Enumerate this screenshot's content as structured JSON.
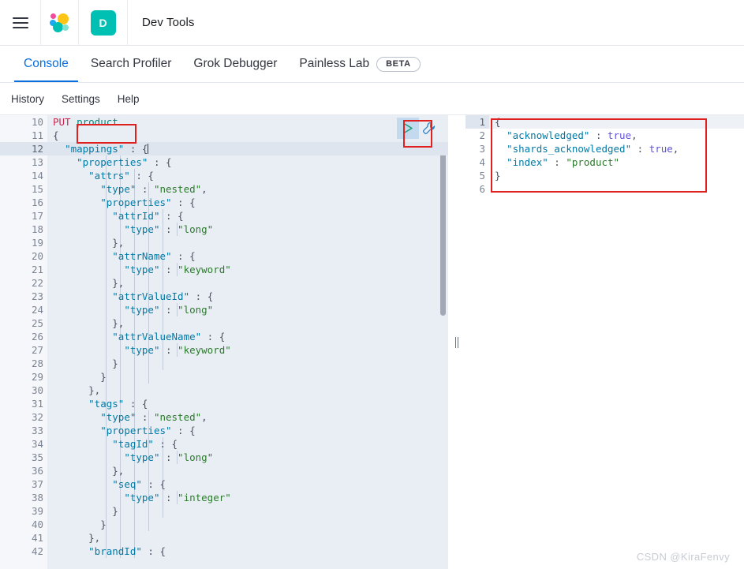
{
  "header": {
    "menu_icon": "hamburger-menu-icon",
    "logo_icon": "elastic-logo-icon",
    "app_badge": "D",
    "app_title": "Dev Tools"
  },
  "tabs": [
    {
      "label": "Console",
      "active": true,
      "badge": null
    },
    {
      "label": "Search Profiler",
      "active": false,
      "badge": null
    },
    {
      "label": "Grok Debugger",
      "active": false,
      "badge": null
    },
    {
      "label": "Painless Lab",
      "active": false,
      "badge": "BETA"
    }
  ],
  "subnav": [
    {
      "label": "History"
    },
    {
      "label": "Settings"
    },
    {
      "label": "Help"
    }
  ],
  "toolbar": {
    "play_label": "send-request",
    "wrench_label": "console-options"
  },
  "request_editor": {
    "first_line_number": 10,
    "active_line": 12,
    "lines": [
      {
        "n": 10,
        "fold": "",
        "indent": 0,
        "tokens": [
          {
            "t": "PUT",
            "c": "k-method"
          },
          {
            "t": " ",
            "c": "k-punct"
          },
          {
            "t": "product",
            "c": "k-url"
          }
        ]
      },
      {
        "n": 11,
        "fold": "▾",
        "indent": 0,
        "tokens": [
          {
            "t": "{",
            "c": "k-punct"
          }
        ]
      },
      {
        "n": 12,
        "fold": "▾",
        "indent": 1,
        "tokens": [
          {
            "t": "\"mappings\"",
            "c": "k-key"
          },
          {
            "t": " : ",
            "c": "k-punct"
          },
          {
            "t": "{",
            "c": "k-punct"
          },
          {
            "t": "|CARET|",
            "c": "caret"
          }
        ]
      },
      {
        "n": 13,
        "fold": "▾",
        "indent": 2,
        "tokens": [
          {
            "t": "\"properties\"",
            "c": "k-key"
          },
          {
            "t": " : ",
            "c": "k-punct"
          },
          {
            "t": "{",
            "c": "k-punct"
          }
        ]
      },
      {
        "n": 14,
        "fold": "▾",
        "indent": 3,
        "tokens": [
          {
            "t": "\"attrs\"",
            "c": "k-key"
          },
          {
            "t": " : ",
            "c": "k-punct"
          },
          {
            "t": "{",
            "c": "k-punct"
          }
        ]
      },
      {
        "n": 15,
        "fold": "",
        "indent": 4,
        "tokens": [
          {
            "t": "\"type\"",
            "c": "k-key"
          },
          {
            "t": " : ",
            "c": "k-punct"
          },
          {
            "t": "\"nested\"",
            "c": "k-str"
          },
          {
            "t": ",",
            "c": "k-punct"
          }
        ]
      },
      {
        "n": 16,
        "fold": "▾",
        "indent": 4,
        "tokens": [
          {
            "t": "\"properties\"",
            "c": "k-key"
          },
          {
            "t": " : ",
            "c": "k-punct"
          },
          {
            "t": "{",
            "c": "k-punct"
          }
        ]
      },
      {
        "n": 17,
        "fold": "▾",
        "indent": 5,
        "tokens": [
          {
            "t": "\"attrId\"",
            "c": "k-key"
          },
          {
            "t": " : ",
            "c": "k-punct"
          },
          {
            "t": "{",
            "c": "k-punct"
          }
        ]
      },
      {
        "n": 18,
        "fold": "",
        "indent": 6,
        "tokens": [
          {
            "t": "\"type\"",
            "c": "k-key"
          },
          {
            "t": " : ",
            "c": "k-punct"
          },
          {
            "t": "\"long\"",
            "c": "k-str"
          }
        ]
      },
      {
        "n": 19,
        "fold": "▴",
        "indent": 5,
        "tokens": [
          {
            "t": "},",
            "c": "k-punct"
          }
        ]
      },
      {
        "n": 20,
        "fold": "▾",
        "indent": 5,
        "tokens": [
          {
            "t": "\"attrName\"",
            "c": "k-key"
          },
          {
            "t": " : ",
            "c": "k-punct"
          },
          {
            "t": "{",
            "c": "k-punct"
          }
        ]
      },
      {
        "n": 21,
        "fold": "",
        "indent": 6,
        "tokens": [
          {
            "t": "\"type\"",
            "c": "k-key"
          },
          {
            "t": " : ",
            "c": "k-punct"
          },
          {
            "t": "\"keyword\"",
            "c": "k-str"
          }
        ]
      },
      {
        "n": 22,
        "fold": "▴",
        "indent": 5,
        "tokens": [
          {
            "t": "},",
            "c": "k-punct"
          }
        ]
      },
      {
        "n": 23,
        "fold": "▾",
        "indent": 5,
        "tokens": [
          {
            "t": "\"attrValueId\"",
            "c": "k-key"
          },
          {
            "t": " : ",
            "c": "k-punct"
          },
          {
            "t": "{",
            "c": "k-punct"
          }
        ]
      },
      {
        "n": 24,
        "fold": "",
        "indent": 6,
        "tokens": [
          {
            "t": "\"type\"",
            "c": "k-key"
          },
          {
            "t": " : ",
            "c": "k-punct"
          },
          {
            "t": "\"long\"",
            "c": "k-str"
          }
        ]
      },
      {
        "n": 25,
        "fold": "▴",
        "indent": 5,
        "tokens": [
          {
            "t": "},",
            "c": "k-punct"
          }
        ]
      },
      {
        "n": 26,
        "fold": "▾",
        "indent": 5,
        "tokens": [
          {
            "t": "\"attrValueName\"",
            "c": "k-key"
          },
          {
            "t": " : ",
            "c": "k-punct"
          },
          {
            "t": "{",
            "c": "k-punct"
          }
        ]
      },
      {
        "n": 27,
        "fold": "",
        "indent": 6,
        "tokens": [
          {
            "t": "\"type\"",
            "c": "k-key"
          },
          {
            "t": " : ",
            "c": "k-punct"
          },
          {
            "t": "\"keyword\"",
            "c": "k-str"
          }
        ]
      },
      {
        "n": 28,
        "fold": "▴",
        "indent": 5,
        "tokens": [
          {
            "t": "}",
            "c": "k-punct"
          }
        ]
      },
      {
        "n": 29,
        "fold": "▴",
        "indent": 4,
        "tokens": [
          {
            "t": "}",
            "c": "k-punct"
          }
        ]
      },
      {
        "n": 30,
        "fold": "▴",
        "indent": 3,
        "tokens": [
          {
            "t": "},",
            "c": "k-punct"
          }
        ]
      },
      {
        "n": 31,
        "fold": "▾",
        "indent": 3,
        "tokens": [
          {
            "t": "\"tags\"",
            "c": "k-key"
          },
          {
            "t": " : ",
            "c": "k-punct"
          },
          {
            "t": "{",
            "c": "k-punct"
          }
        ]
      },
      {
        "n": 32,
        "fold": "",
        "indent": 4,
        "tokens": [
          {
            "t": "\"type\"",
            "c": "k-key"
          },
          {
            "t": " : ",
            "c": "k-punct"
          },
          {
            "t": "\"nested\"",
            "c": "k-str"
          },
          {
            "t": ",",
            "c": "k-punct"
          }
        ]
      },
      {
        "n": 33,
        "fold": "▾",
        "indent": 4,
        "tokens": [
          {
            "t": "\"properties\"",
            "c": "k-key"
          },
          {
            "t": " : ",
            "c": "k-punct"
          },
          {
            "t": "{",
            "c": "k-punct"
          }
        ]
      },
      {
        "n": 34,
        "fold": "▾",
        "indent": 5,
        "tokens": [
          {
            "t": "\"tagId\"",
            "c": "k-key"
          },
          {
            "t": " : ",
            "c": "k-punct"
          },
          {
            "t": "{",
            "c": "k-punct"
          }
        ]
      },
      {
        "n": 35,
        "fold": "",
        "indent": 6,
        "tokens": [
          {
            "t": "\"type\"",
            "c": "k-key"
          },
          {
            "t": " : ",
            "c": "k-punct"
          },
          {
            "t": "\"long\"",
            "c": "k-str"
          }
        ]
      },
      {
        "n": 36,
        "fold": "▴",
        "indent": 5,
        "tokens": [
          {
            "t": "},",
            "c": "k-punct"
          }
        ]
      },
      {
        "n": 37,
        "fold": "▾",
        "indent": 5,
        "tokens": [
          {
            "t": "\"seq\"",
            "c": "k-key"
          },
          {
            "t": " : ",
            "c": "k-punct"
          },
          {
            "t": "{",
            "c": "k-punct"
          }
        ]
      },
      {
        "n": 38,
        "fold": "",
        "indent": 6,
        "tokens": [
          {
            "t": "\"type\"",
            "c": "k-key"
          },
          {
            "t": " : ",
            "c": "k-punct"
          },
          {
            "t": "\"integer\"",
            "c": "k-str"
          }
        ]
      },
      {
        "n": 39,
        "fold": "▴",
        "indent": 5,
        "tokens": [
          {
            "t": "}",
            "c": "k-punct"
          }
        ]
      },
      {
        "n": 40,
        "fold": "▴",
        "indent": 4,
        "tokens": [
          {
            "t": "}",
            "c": "k-punct"
          }
        ]
      },
      {
        "n": 41,
        "fold": "▴",
        "indent": 3,
        "tokens": [
          {
            "t": "},",
            "c": "k-punct"
          }
        ]
      },
      {
        "n": 42,
        "fold": "▾",
        "indent": 3,
        "tokens": [
          {
            "t": "\"brandId\"",
            "c": "k-key"
          },
          {
            "t": " : ",
            "c": "k-punct"
          },
          {
            "t": "{",
            "c": "k-punct"
          }
        ]
      }
    ]
  },
  "response_editor": {
    "active_line": 1,
    "lines": [
      {
        "n": 1,
        "fold": "▾",
        "indent": 0,
        "tokens": [
          {
            "t": "{",
            "c": "k-punct"
          }
        ]
      },
      {
        "n": 2,
        "fold": "",
        "indent": 1,
        "tokens": [
          {
            "t": "\"acknowledged\"",
            "c": "k-key"
          },
          {
            "t": " : ",
            "c": "k-punct"
          },
          {
            "t": "true",
            "c": "k-bool"
          },
          {
            "t": ",",
            "c": "k-punct"
          }
        ]
      },
      {
        "n": 3,
        "fold": "",
        "indent": 1,
        "tokens": [
          {
            "t": "\"shards_acknowledged\"",
            "c": "k-key"
          },
          {
            "t": " : ",
            "c": "k-punct"
          },
          {
            "t": "true",
            "c": "k-bool"
          },
          {
            "t": ",",
            "c": "k-punct"
          }
        ]
      },
      {
        "n": 4,
        "fold": "",
        "indent": 1,
        "tokens": [
          {
            "t": "\"index\"",
            "c": "k-key"
          },
          {
            "t": " : ",
            "c": "k-punct"
          },
          {
            "t": "\"product\"",
            "c": "k-str"
          }
        ]
      },
      {
        "n": 5,
        "fold": "▴",
        "indent": 0,
        "tokens": [
          {
            "t": "}",
            "c": "k-punct"
          }
        ]
      },
      {
        "n": 6,
        "fold": "",
        "indent": 0,
        "tokens": [
          {
            "t": "",
            "c": "k-punct"
          }
        ]
      }
    ]
  },
  "annotations": [
    {
      "name": "url-highlight",
      "color": "#e01f1f"
    },
    {
      "name": "play-button-highlight",
      "color": "#e01f1f"
    },
    {
      "name": "response-highlight",
      "color": "#e01f1f"
    }
  ],
  "watermark": "CSDN @KiraFenvy"
}
